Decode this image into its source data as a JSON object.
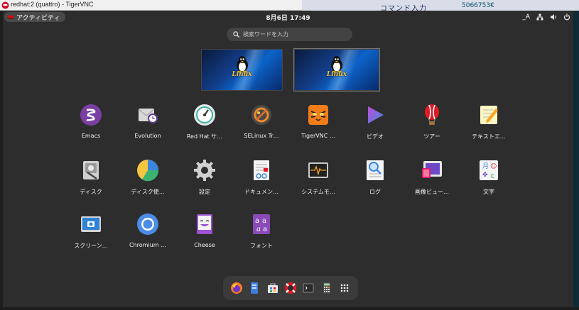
{
  "window": {
    "title": "redhat:2 (quattro) - TigerVNC",
    "behind_text_1": "コマンド入力",
    "behind_text_2": "5066753€"
  },
  "topbar": {
    "activities_label": "アクティビティ",
    "clock": "8月6日  17:49",
    "ime_label": "_A"
  },
  "search": {
    "placeholder": "検索ワードを入力"
  },
  "workspaces": [
    {
      "label": "Linux"
    },
    {
      "label": "Linux"
    }
  ],
  "apps": [
    {
      "name": "Emacs",
      "icon": "emacs-icon"
    },
    {
      "name": "Evolution",
      "icon": "evolution-icon"
    },
    {
      "name": "Red Hat サ…",
      "icon": "redhat-support-icon"
    },
    {
      "name": "SELinux Tr…",
      "icon": "selinux-troubleshooter-icon"
    },
    {
      "name": "TigerVNC …",
      "icon": "tigervnc-icon"
    },
    {
      "name": "ビデオ",
      "icon": "videos-icon"
    },
    {
      "name": "ツアー",
      "icon": "tour-icon"
    },
    {
      "name": "テキストエ…",
      "icon": "text-editor-icon"
    },
    {
      "name": "ディスク",
      "icon": "disks-icon"
    },
    {
      "name": "ディスク使…",
      "icon": "disk-usage-icon"
    },
    {
      "name": "設定",
      "icon": "settings-icon"
    },
    {
      "name": "ドキュメン…",
      "icon": "document-viewer-icon"
    },
    {
      "name": "システムモ…",
      "icon": "system-monitor-icon"
    },
    {
      "name": "ログ",
      "icon": "logs-icon"
    },
    {
      "name": "画像ビュー…",
      "icon": "image-viewer-icon"
    },
    {
      "name": "文字",
      "icon": "characters-icon"
    },
    {
      "name": "スクリーン…",
      "icon": "screenshot-icon"
    },
    {
      "name": "Chromium …",
      "icon": "chromium-icon"
    },
    {
      "name": "Cheese",
      "icon": "cheese-icon"
    },
    {
      "name": "フォント",
      "icon": "fonts-icon"
    }
  ],
  "dock": [
    "firefox-icon",
    "files-icon",
    "software-icon",
    "help-icon",
    "terminal-icon",
    "calculator-icon",
    "show-apps-icon"
  ]
}
